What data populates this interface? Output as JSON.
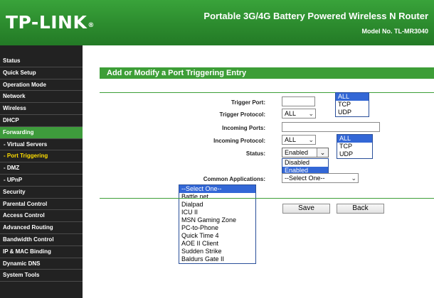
{
  "header": {
    "logo": "TP-LINK",
    "logo_mark": "®",
    "title": "Portable 3G/4G Battery Powered Wireless N Router",
    "model": "Model No. TL-MR3040"
  },
  "sidebar": {
    "items": [
      {
        "label": "Status"
      },
      {
        "label": "Quick Setup"
      },
      {
        "label": "Operation Mode"
      },
      {
        "label": "Network"
      },
      {
        "label": "Wireless"
      },
      {
        "label": "DHCP"
      },
      {
        "label": "Forwarding"
      },
      {
        "label": "- Virtual Servers"
      },
      {
        "label": "- Port Triggering"
      },
      {
        "label": "- DMZ"
      },
      {
        "label": "- UPnP"
      },
      {
        "label": "Security"
      },
      {
        "label": "Parental Control"
      },
      {
        "label": "Access Control"
      },
      {
        "label": "Advanced Routing"
      },
      {
        "label": "Bandwidth Control"
      },
      {
        "label": "IP & MAC Binding"
      },
      {
        "label": "Dynamic DNS"
      },
      {
        "label": "System Tools"
      }
    ]
  },
  "form": {
    "section_title": "Add or Modify a Port Triggering Entry",
    "trigger_port_label": "Trigger Port:",
    "trigger_port_value": "",
    "trigger_protocol_label": "Trigger Protocol:",
    "trigger_protocol_value": "ALL",
    "trigger_protocol_options": [
      "ALL",
      "TCP",
      "UDP"
    ],
    "incoming_ports_label": "Incoming Ports:",
    "incoming_ports_value": "",
    "incoming_protocol_label": "Incoming Protocol:",
    "incoming_protocol_value": "ALL",
    "incoming_protocol_options": [
      "ALL",
      "TCP",
      "UDP"
    ],
    "status_label": "Status:",
    "status_value": "Enabled",
    "status_options": [
      "Disabled",
      "Enabled"
    ],
    "common_apps_label": "Common Applications:",
    "common_apps_value": "--Select One--",
    "common_apps_options": [
      "--Select One--",
      "Battle.net",
      "Dialpad",
      "ICU II",
      "MSN Gaming Zone",
      "PC-to-Phone",
      "Quick Time 4",
      "AOE II Client",
      "Sudden Strike",
      "Baldurs Gate II"
    ],
    "save_label": "Save",
    "back_label": "Back"
  },
  "colors": {
    "brand_green": "#3d9e37",
    "sidebar_bg": "#222222",
    "active_item_text": "#ffde00",
    "dropdown_highlight": "#3367d6"
  }
}
